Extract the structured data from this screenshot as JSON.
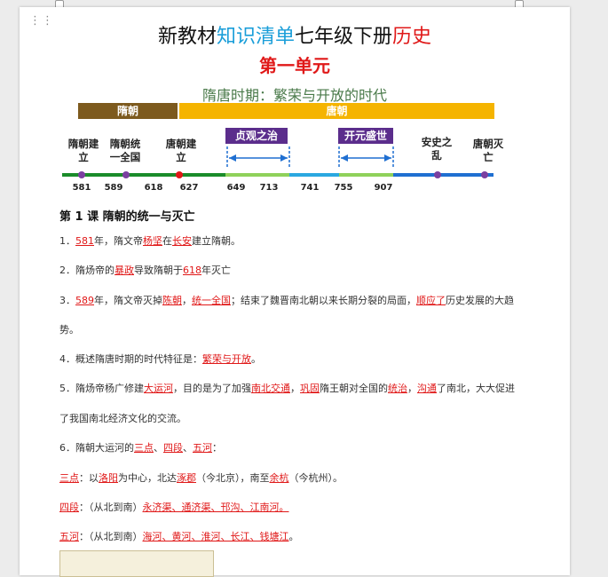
{
  "title": {
    "part1": "新教材",
    "part2": "知识清单",
    "part3": "七年级下册",
    "part4": "历史"
  },
  "unit": "第一单元",
  "period": "隋唐时期：繁荣与开放的时代",
  "timeline": {
    "sui": "隋朝",
    "tang": "唐朝",
    "events": [
      "隋朝建立",
      "隋朝统一全国",
      "唐朝建立",
      "安史之乱",
      "唐朝灭亡"
    ],
    "zhenguan": "贞观之治",
    "kaiyuan": "开元盛世",
    "years": [
      "581",
      "589",
      "618",
      "627",
      "649",
      "713",
      "741",
      "755",
      "907"
    ],
    "colors": {
      "sui": "#7d5a1e",
      "tang": "#f5b400",
      "arrow": "#1f6fd1",
      "box": "#5b2d8c"
    }
  },
  "lesson": "第 1 课 隋朝的统一与灭亡",
  "l1": {
    "a": "1．",
    "b": "581",
    "c": "年，隋文帝",
    "d": "杨坚",
    "e": "在",
    "f": "长安",
    "g": "建立隋朝。"
  },
  "l2": {
    "a": "2．隋炀帝的",
    "b": "暴政",
    "c": "导致隋朝于",
    "d": "618",
    "e": "年灭亡"
  },
  "l3": {
    "a": "3．",
    "b": "589",
    "c": "年，隋文帝灭掉",
    "d": "陈朝",
    "e": "，",
    "f": "统一全国",
    "g": "；结束了魏晋南北朝以来长期分裂的局面，",
    "h": "顺应了",
    "i": "历史发展的大趋"
  },
  "l3b": "势。",
  "l4": {
    "a": "4．概述隋唐时期的时代特征是：",
    "b": "繁荣与开放",
    "c": "。"
  },
  "l5": {
    "a": "5．隋炀帝杨广修建",
    "b": "大运河",
    "c": "，目的是为了加强",
    "d": "南北交通",
    "e": "，",
    "f": "巩固",
    "g": "隋王朝对全国的",
    "h": "统治",
    "i": "，",
    "j": "沟通",
    "k": "了南北，大大促进"
  },
  "l5b": "了我国南北经济文化的交流。",
  "l6": {
    "a": "6．隋朝大运河的",
    "b": "三点",
    "c": "、",
    "d": "四段",
    "e": "、",
    "f": "五河",
    "g": "："
  },
  "l7": {
    "a": "三点",
    "b": "：以",
    "c": "洛阳",
    "d": "为中心，北达",
    "e": "涿郡",
    "f": "（今北京），南至",
    "g": "余杭",
    "h": "（今杭州）。"
  },
  "l8": {
    "a": "四段",
    "b": "：（从北到南）",
    "c": "永济渠、通济渠、邗沟、江南河。"
  },
  "l9": {
    "a": "五河",
    "b": "：（从北到南）",
    "c": "海河、黄河、淮河、长江、钱塘江",
    "d": "。"
  }
}
